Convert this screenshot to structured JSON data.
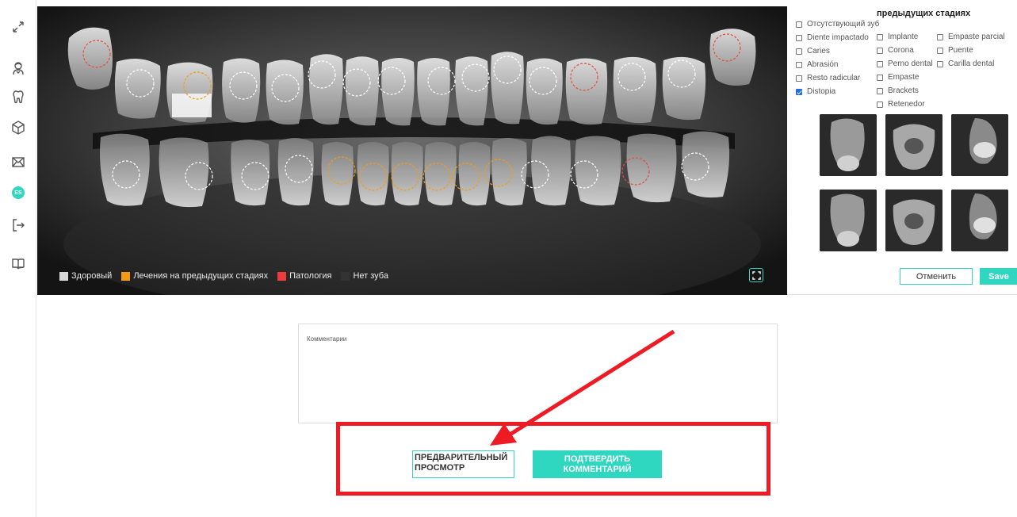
{
  "sidebar": {
    "icons": [
      "expand-icon",
      "dentist-icon",
      "tooth-icon",
      "cube-icon",
      "mail-icon",
      "language-icon",
      "logout-icon",
      "book-icon"
    ],
    "language_badge": "ES"
  },
  "xray": {
    "legend": [
      {
        "label": "Здоровый",
        "color": "#d9d9d9"
      },
      {
        "label": "Лечения на предыдущих стадиях",
        "color": "#f39c12"
      },
      {
        "label": "Патология",
        "color": "#ee3b3b"
      },
      {
        "label": "Нет зуба",
        "color": "#333333"
      }
    ],
    "marker_colors": {
      "healthy": "#ffffff",
      "treated": "#f39c12",
      "pathology": "#e74c3c"
    }
  },
  "right_panel": {
    "header": "предыдущих стадиях",
    "col1": [
      {
        "label": "Отсутствующий зуб",
        "checked": false
      },
      {
        "label": "Diente impactado",
        "checked": false
      },
      {
        "label": "Caries",
        "checked": false
      },
      {
        "label": "Abrasión",
        "checked": false
      },
      {
        "label": "Resto radicular",
        "checked": false
      },
      {
        "label": "Distopia",
        "checked": true
      }
    ],
    "col2": [
      {
        "label": "Implante",
        "checked": false
      },
      {
        "label": "Corona",
        "checked": false
      },
      {
        "label": "Perno dental",
        "checked": false
      },
      {
        "label": "Empaste",
        "checked": false
      },
      {
        "label": "Brackets",
        "checked": false
      },
      {
        "label": "Retenedor",
        "checked": false
      }
    ],
    "col3": [
      {
        "label": "Empaste parcial",
        "checked": false
      },
      {
        "label": "Puente",
        "checked": false
      },
      {
        "label": "Carilla dental",
        "checked": false
      }
    ],
    "cancel_label": "Отменить",
    "save_label": "Save"
  },
  "comments": {
    "placeholder": "Комментарии"
  },
  "actions": {
    "preview_label": "ПРЕДВАРИТЕЛЬНЫЙ ПРОСМОТР",
    "confirm_label": "ПОДТВЕРДИТЬ КОММЕНТАРИЙ"
  },
  "annotation": {
    "highlight_color": "#ee1b24",
    "arrow_color": "#ee1b24"
  }
}
